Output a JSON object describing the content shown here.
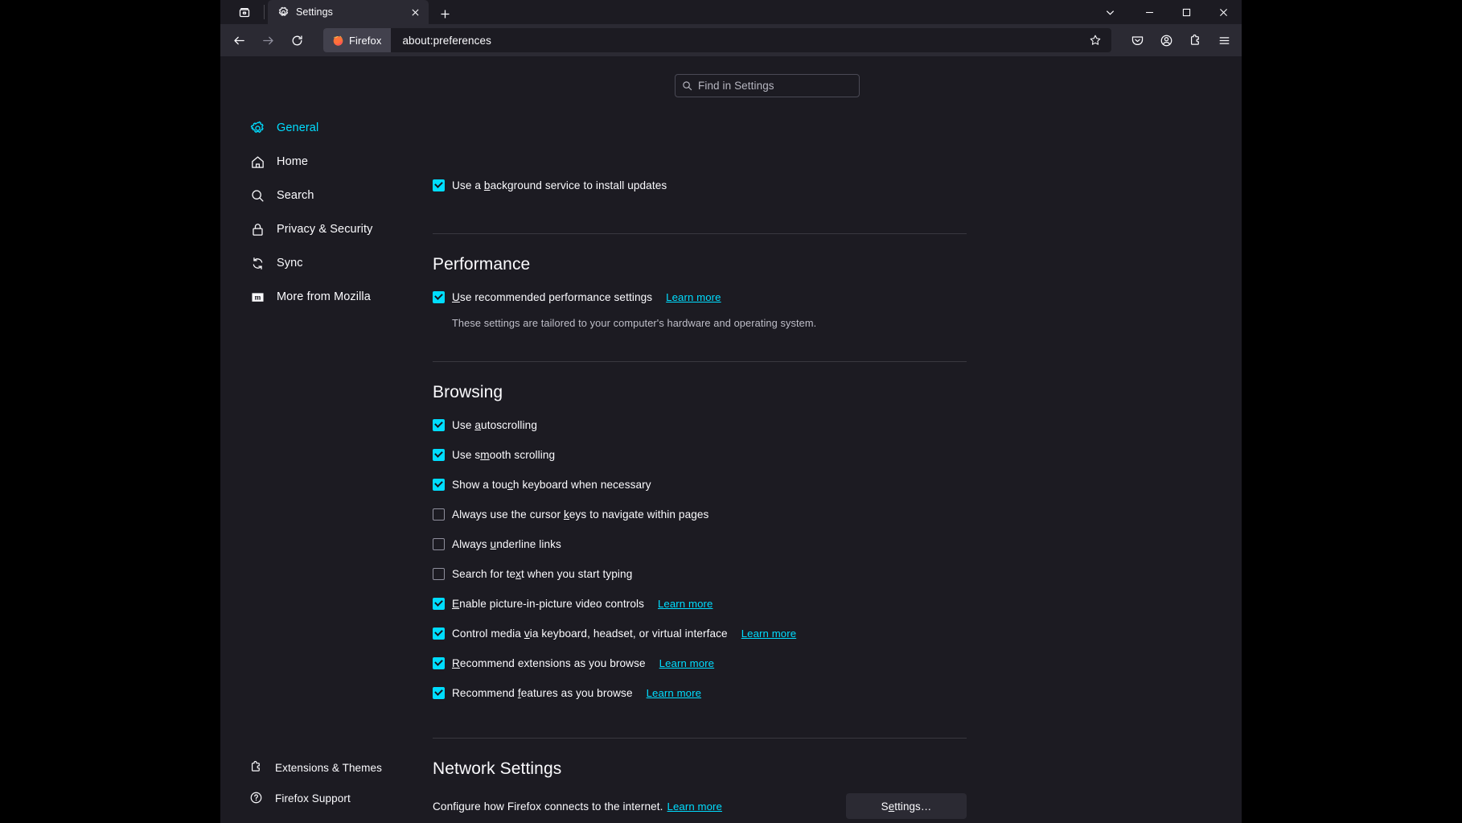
{
  "window": {
    "tab": {
      "title": "Settings",
      "icon": "gear-icon",
      "close_label": "×"
    },
    "new_tab_label": "+",
    "firefox_view_label": "Firefox View",
    "controls": {
      "tab_list": "List all tabs",
      "minimize": "Minimize",
      "maximize": "Maximize",
      "close": "Close"
    }
  },
  "toolbar": {
    "back_label": "Go back one page",
    "forward_label": "Go forward one page",
    "reload_label": "Reload current page",
    "url_chip": "Firefox",
    "url": "about:preferences",
    "bookmark_label": "Bookmark this page",
    "pocket_label": "Save to Pocket",
    "account_label": "Account",
    "extensions_label": "Extensions",
    "menu_label": "Open application menu"
  },
  "search": {
    "placeholder": "Find in Settings",
    "icon": "search-icon"
  },
  "sidebar": {
    "items": [
      {
        "label": "General",
        "icon": "gear-icon",
        "active": true
      },
      {
        "label": "Home",
        "icon": "home-icon",
        "active": false
      },
      {
        "label": "Search",
        "icon": "search-icon",
        "active": false
      },
      {
        "label": "Privacy & Security",
        "icon": "lock-icon",
        "active": false
      },
      {
        "label": "Sync",
        "icon": "sync-icon",
        "active": false
      },
      {
        "label": "More from Mozilla",
        "icon": "mozilla-icon",
        "active": false
      }
    ],
    "footer": [
      {
        "label": "Extensions & Themes",
        "icon": "puzzle-icon"
      },
      {
        "label": "Firefox Support",
        "icon": "question-circle-icon"
      }
    ]
  },
  "main": {
    "updates_checkbox": {
      "label_before": "Use a ",
      "accesskey": "b",
      "label_after": "ackground service to install updates",
      "checked": true
    },
    "performance": {
      "title": "Performance",
      "recommended": {
        "label_before": "",
        "accesskey": "U",
        "label_after": "se recommended performance settings",
        "checked": true,
        "learn_more": "Learn more"
      },
      "description": "These settings are tailored to your computer's hardware and operating system."
    },
    "browsing": {
      "title": "Browsing",
      "items": [
        {
          "label_before": "Use ",
          "accesskey": "a",
          "label_after": "utoscrolling",
          "checked": true,
          "learn_more": ""
        },
        {
          "label_before": "Use s",
          "accesskey": "m",
          "label_after": "ooth scrolling",
          "checked": true,
          "learn_more": ""
        },
        {
          "label_before": "Show a tou",
          "accesskey": "c",
          "label_after": "h keyboard when necessary",
          "checked": true,
          "learn_more": ""
        },
        {
          "label_before": "Always use the cursor ",
          "accesskey": "k",
          "label_after": "eys to navigate within pages",
          "checked": false,
          "learn_more": ""
        },
        {
          "label_before": "Always ",
          "accesskey": "u",
          "label_after": "nderline links",
          "checked": false,
          "learn_more": ""
        },
        {
          "label_before": "Search for te",
          "accesskey": "x",
          "label_after": "t when you start typing",
          "checked": false,
          "learn_more": ""
        },
        {
          "label_before": "",
          "accesskey": "E",
          "label_after": "nable picture-in-picture video controls",
          "checked": true,
          "learn_more": "Learn more"
        },
        {
          "label_before": "Control media ",
          "accesskey": "v",
          "label_after": "ia keyboard, headset, or virtual interface",
          "checked": true,
          "learn_more": "Learn more"
        },
        {
          "label_before": "",
          "accesskey": "R",
          "label_after": "ecommend extensions as you browse",
          "checked": true,
          "learn_more": "Learn more"
        },
        {
          "label_before": "Recommend ",
          "accesskey": "f",
          "label_after": "eatures as you browse",
          "checked": true,
          "learn_more": "Learn more"
        }
      ]
    },
    "network": {
      "title": "Network Settings",
      "description": "Configure how Firefox connects to the internet.",
      "learn_more": "Learn more",
      "button_before": "S",
      "button_accesskey": "e",
      "button_after": "ttings…"
    }
  },
  "colors": {
    "accent": "#00ddff",
    "window_bg": "#1c1b22",
    "chrome_bg": "#2b2a33",
    "text": "#fbfbfe"
  }
}
